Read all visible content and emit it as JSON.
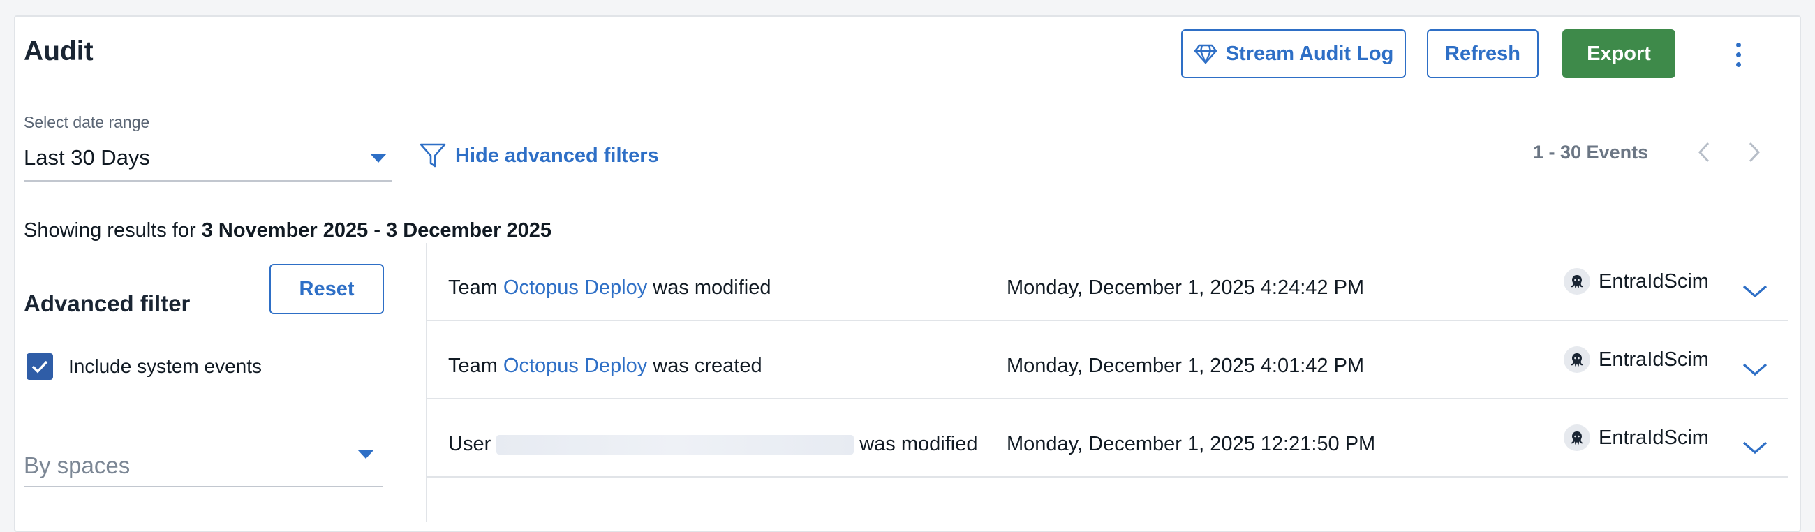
{
  "header": {
    "title": "Audit",
    "stream_label": "Stream Audit Log",
    "refresh_label": "Refresh",
    "export_label": "Export"
  },
  "date_range": {
    "label": "Select date range",
    "value": "Last 30 Days"
  },
  "advanced_toggle_label": "Hide advanced filters",
  "pagination": {
    "count_label": "1 - 30 Events"
  },
  "showing": {
    "prefix": "Showing results for",
    "range": "3 November 2025 - 3 December 2025"
  },
  "filter": {
    "title": "Advanced filter",
    "reset_label": "Reset",
    "include_system_label": "Include system events",
    "include_system_checked": true,
    "spaces_placeholder": "By spaces"
  },
  "events": [
    {
      "prefix": "Team",
      "link": "Octopus Deploy",
      "suffix": "was modified",
      "date": "Monday, December 1, 2025 4:24:42 PM",
      "user": "EntraIdScim"
    },
    {
      "prefix": "Team",
      "link": "Octopus Deploy",
      "suffix": "was created",
      "date": "Monday, December 1, 2025 4:01:42 PM",
      "user": "EntraIdScim"
    },
    {
      "prefix": "User",
      "link": "",
      "suffix": "was modified",
      "date": "Monday, December 1, 2025 12:21:50 PM",
      "user": "EntraIdScim"
    }
  ],
  "colors": {
    "accent": "#2e6fc6",
    "export_green": "#3e8a4a",
    "checkbox_blue": "#2f5da7"
  },
  "icons": {
    "stream": "diamond-icon",
    "more": "kebab-icon",
    "filter": "filter-funnel-icon",
    "prev": "chevron-left-icon",
    "next": "chevron-right-icon",
    "expand": "chevron-down-icon",
    "avatar": "octopus-icon"
  }
}
